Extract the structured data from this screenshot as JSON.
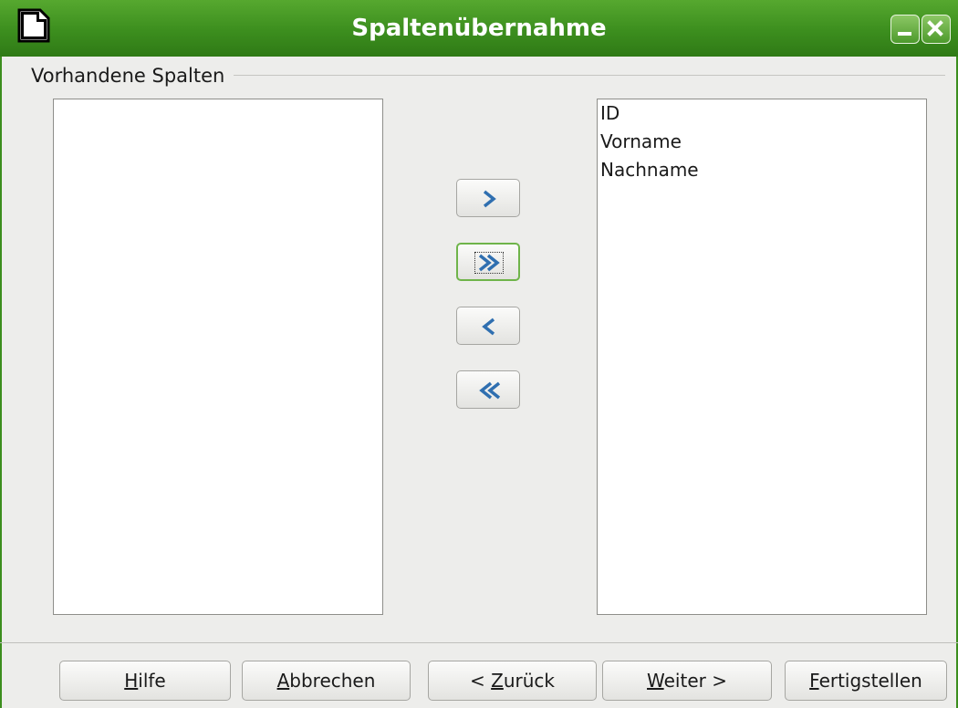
{
  "window": {
    "title": "Spaltenübernahme",
    "colors": {
      "titlebar": "#3c8e1e",
      "focus_border": "#6fb44a",
      "arrow_icon": "#2f6fb0"
    }
  },
  "group": {
    "label": "Vorhandene Spalten"
  },
  "left_list": {
    "items": []
  },
  "right_list": {
    "items": [
      "ID",
      "Vorname",
      "Nachname"
    ]
  },
  "transfer_buttons": [
    {
      "name": "move-selected-right",
      "icon": "single-chevron-right-icon"
    },
    {
      "name": "move-all-right",
      "icon": "double-chevron-right-icon",
      "focused": true
    },
    {
      "name": "move-selected-left",
      "icon": "single-chevron-left-icon"
    },
    {
      "name": "move-all-left",
      "icon": "double-chevron-left-icon"
    }
  ],
  "footer": {
    "help": {
      "mnemonic": "H",
      "rest": "ilfe"
    },
    "cancel": {
      "mnemonic": "A",
      "rest": "bbrechen"
    },
    "back": {
      "prefix": "< ",
      "mnemonic": "Z",
      "rest": "urück"
    },
    "next": {
      "mnemonic": "W",
      "rest": "eiter >"
    },
    "finish": {
      "mnemonic": "F",
      "rest": "ertigstellen"
    }
  }
}
